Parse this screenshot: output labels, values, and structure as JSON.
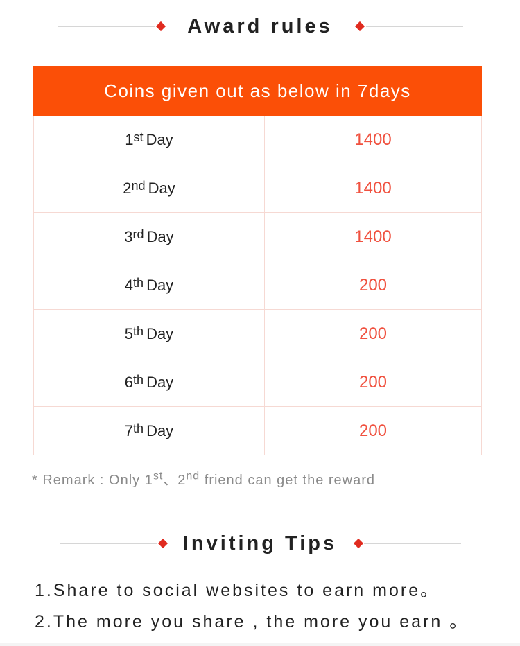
{
  "award_rules": {
    "title": "Award rules"
  },
  "table": {
    "header": "Coins given out as below in 7days",
    "rows": [
      {
        "num": "1",
        "suffix": "st",
        "day": "Day",
        "coins": "1400"
      },
      {
        "num": "2",
        "suffix": "nd",
        "day": "Day",
        "coins": "1400"
      },
      {
        "num": "3",
        "suffix": "rd",
        "day": "Day",
        "coins": "1400"
      },
      {
        "num": "4",
        "suffix": "th",
        "day": "Day",
        "coins": "200"
      },
      {
        "num": "5",
        "suffix": "th",
        "day": "Day",
        "coins": "200"
      },
      {
        "num": "6",
        "suffix": "th",
        "day": "Day",
        "coins": "200"
      },
      {
        "num": "7",
        "suffix": "th",
        "day": "Day",
        "coins": "200"
      }
    ]
  },
  "remark": {
    "prefix": "* Remark : Only  1",
    "sup1": "st",
    "mid": "、2",
    "sup2": "nd",
    "suffix": " friend can get the reward"
  },
  "inviting_tips": {
    "title": "Inviting Tips",
    "tips": [
      "1.Share to social websites to earn more。",
      "2.The more you share , the more you earn 。"
    ]
  },
  "colors": {
    "accent": "#fb4f07",
    "diamond": "#e02b1f",
    "coins_text": "#f0513f",
    "border": "#f6d9d3",
    "remark_text": "#8a8a8a"
  },
  "icons": {
    "heading_decoration": "diamond-icon"
  }
}
